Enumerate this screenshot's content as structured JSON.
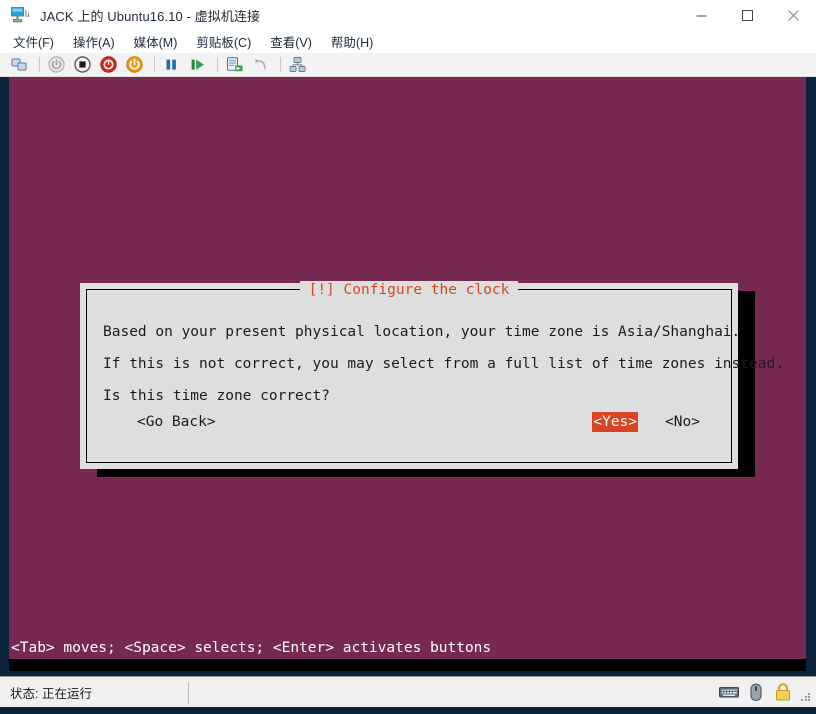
{
  "window": {
    "title": "JACK 上的 Ubuntu16.10 - 虚拟机连接",
    "icon": "virtual-machine-icon",
    "controls": {
      "minimize": "—",
      "maximize": "□",
      "close": "✕"
    }
  },
  "menubar": {
    "items": [
      {
        "label": "文件(F)",
        "name": "menu-file"
      },
      {
        "label": "操作(A)",
        "name": "menu-action"
      },
      {
        "label": "媒体(M)",
        "name": "menu-media"
      },
      {
        "label": "剪贴板(C)",
        "name": "menu-clipboard"
      },
      {
        "label": "查看(V)",
        "name": "menu-view"
      },
      {
        "label": "帮助(H)",
        "name": "menu-help"
      }
    ]
  },
  "toolbar": {
    "items": [
      {
        "name": "ctrl-alt-del-icon",
        "tip": "Ctrl+Alt+Delete"
      },
      {
        "name": "power-on-icon",
        "tip": "启动"
      },
      {
        "name": "shutdown-icon",
        "tip": "关机"
      },
      {
        "name": "turn-off-icon",
        "tip": "关闭"
      },
      {
        "name": "save-state-icon",
        "tip": "保存"
      },
      {
        "name": "pause-icon",
        "tip": "暂停"
      },
      {
        "name": "resume-icon",
        "tip": "继续"
      },
      {
        "name": "checkpoint-icon",
        "tip": "检查点"
      },
      {
        "name": "revert-icon",
        "tip": "还原"
      },
      {
        "name": "enhanced-session-icon",
        "tip": "增强会话"
      }
    ]
  },
  "vm": {
    "background_color": "#772953",
    "dialog": {
      "title": "[!] Configure the clock",
      "title_color": "#d94425",
      "background_color": "#dedede",
      "lines": [
        "Based on your present physical location, your time zone is Asia/Shanghai.",
        "If this is not correct, you may select from a full list of time zones instead.",
        "Is this time zone correct?"
      ],
      "buttons": [
        {
          "label": "<Go Back>",
          "name": "go-back-button",
          "selected": false
        },
        {
          "label": "<Yes>",
          "name": "yes-button",
          "selected": true
        },
        {
          "label": "<No>",
          "name": "no-button",
          "selected": false
        }
      ],
      "selected_button_bg": "#d94425",
      "selected_button_fg": "#ffffff"
    },
    "help_bar": "<Tab> moves; <Space> selects; <Enter> activates buttons"
  },
  "statusbar": {
    "status": "状态: 正在运行",
    "icons": [
      {
        "name": "keyboard-icon"
      },
      {
        "name": "mouse-icon"
      },
      {
        "name": "lock-icon"
      }
    ]
  }
}
